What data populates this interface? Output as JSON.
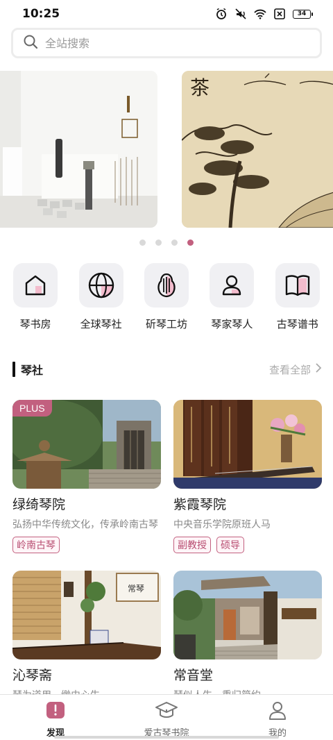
{
  "status_bar": {
    "time": "10:25",
    "battery": "34"
  },
  "search": {
    "placeholder": "全站搜索"
  },
  "banner": {
    "slide_b_title": "茶",
    "dots": 4,
    "active_dot": 3
  },
  "quick_nav": [
    {
      "label": "琴书房",
      "icon": "house-icon"
    },
    {
      "label": "全球琴社",
      "icon": "globe-icon"
    },
    {
      "label": "斫琴工坊",
      "icon": "guqin-icon"
    },
    {
      "label": "琴家琴人",
      "icon": "person-icon"
    },
    {
      "label": "古琴谱书",
      "icon": "book-icon"
    }
  ],
  "section": {
    "title": "琴社",
    "see_all": "查看全部"
  },
  "cards": [
    {
      "title": "绿绮琴院",
      "desc": "弘扬中华传统文化，传承岭南古琴",
      "tags": [
        "岭南古琴"
      ],
      "badge": "PLUS"
    },
    {
      "title": "紫霞琴院",
      "desc": "中央音乐学院原班人马",
      "tags": [
        "副教授",
        "硕导"
      ]
    },
    {
      "title": "沁琴斋",
      "desc": "琴为道用，缈由心生"
    },
    {
      "title": "常音堂",
      "desc": "琴似人生，重归简约"
    }
  ],
  "tab_bar": [
    {
      "label": "发现",
      "active": true
    },
    {
      "label": "爱古琴书院",
      "active": false
    },
    {
      "label": "我的",
      "active": false
    }
  ],
  "colors": {
    "accent": "#c2607f",
    "accent_light": "#f3bccd"
  }
}
